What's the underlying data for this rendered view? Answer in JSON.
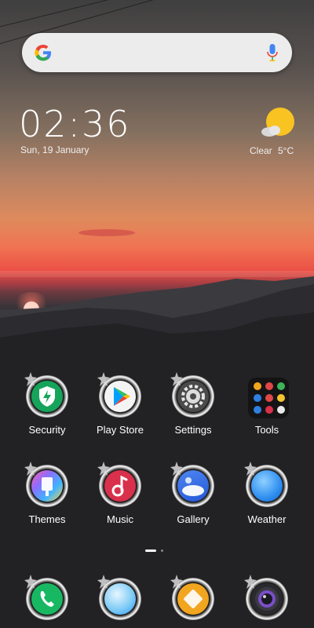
{
  "search": {
    "logo": "google-g-icon",
    "mic_icon": "microphone-icon"
  },
  "clock": {
    "time": "02:36",
    "date": "Sun, 19 January"
  },
  "weather": {
    "condition": "Clear",
    "temperature": "5°C",
    "icon": "sun-partly-cloudy-icon"
  },
  "apps": [
    {
      "label": "Security",
      "icon": "security-shield-icon"
    },
    {
      "label": "Play Store",
      "icon": "play-store-icon"
    },
    {
      "label": "Settings",
      "icon": "settings-gear-icon"
    },
    {
      "label": "Tools",
      "icon": "tools-folder-icon"
    },
    {
      "label": "Themes",
      "icon": "themes-brush-icon"
    },
    {
      "label": "Music",
      "icon": "music-note-icon"
    },
    {
      "label": "Gallery",
      "icon": "gallery-icon"
    },
    {
      "label": "Weather",
      "icon": "weather-icon"
    }
  ],
  "dock": [
    {
      "icon": "phone-icon"
    },
    {
      "icon": "messages-icon"
    },
    {
      "icon": "notes-icon"
    },
    {
      "icon": "camera-icon"
    }
  ],
  "page_indicator": {
    "pages": 2,
    "current": 1
  },
  "colors": {
    "security": "#16a35a",
    "music": "#d9304b",
    "gallery": "#3c6ee0",
    "weather": "#2f8ff0",
    "phone": "#18b862",
    "notes": "#f2a51f",
    "sky_glow": "#f07352"
  }
}
